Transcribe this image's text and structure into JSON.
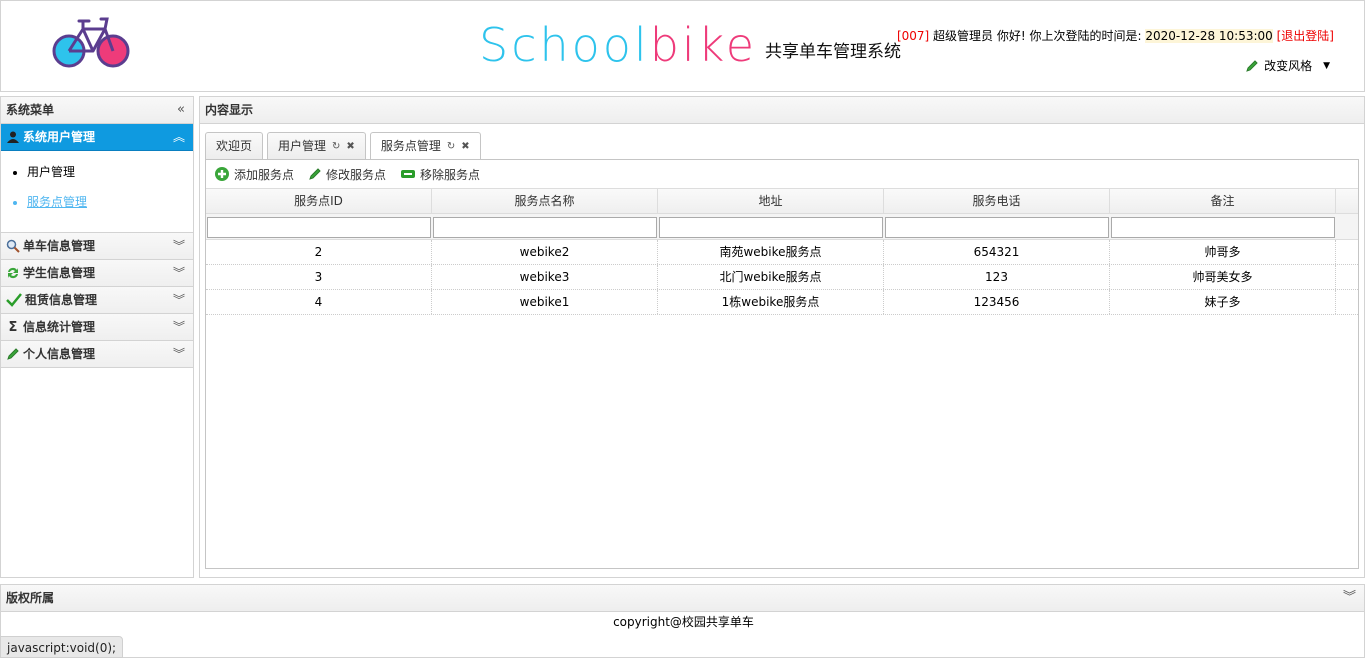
{
  "header": {
    "brand_school": "Schoolbike",
    "brand_school_a": "School",
    "brand_school_b": "bike",
    "brand_subtitle": "共享单车管理系统",
    "user_code": "[007]",
    "user_role": " 超级管理员 你好! 你上次登陆的时间是: ",
    "last_login": "2020-12-28 10:53:00",
    "logout": "[退出登陆]",
    "change_theme": "改变风格"
  },
  "west": {
    "title": "系统菜单",
    "sections": [
      {
        "label": "系统用户管理",
        "icon": "user-icon"
      },
      {
        "label": "单车信息管理",
        "icon": "search-icon"
      },
      {
        "label": "学生信息管理",
        "icon": "refresh-icon"
      },
      {
        "label": "租赁信息管理",
        "icon": "check-icon"
      },
      {
        "label": "信息统计管理",
        "icon": "sigma-icon"
      },
      {
        "label": "个人信息管理",
        "icon": "pencil-icon"
      }
    ],
    "active_items": [
      "用户管理",
      "服务点管理"
    ]
  },
  "center": {
    "title": "内容显示",
    "tabs": [
      {
        "label": "欢迎页"
      },
      {
        "label": "用户管理"
      },
      {
        "label": "服务点管理"
      }
    ],
    "toolbar": {
      "add": "添加服务点",
      "edit": "修改服务点",
      "remove": "移除服务点"
    },
    "grid": {
      "columns": [
        "服务点ID",
        "服务点名称",
        "地址",
        "服务电话",
        "备注"
      ],
      "rows": [
        [
          "2",
          "webike2",
          "南苑webike服务点",
          "654321",
          "帅哥多"
        ],
        [
          "3",
          "webike3",
          "北门webike服务点",
          "123",
          "帅哥美女多"
        ],
        [
          "4",
          "webike1",
          "1栋webike服务点",
          "123456",
          "妹子多"
        ]
      ]
    }
  },
  "south": {
    "title": "版权所属",
    "copyright": "copyright@校园共享单车"
  },
  "statusbar": "javascript:void(0);",
  "colors": {
    "accent": "#0f9ae0",
    "brand_school": "#2ec3ec",
    "brand_bike": "#ee3b7a"
  }
}
